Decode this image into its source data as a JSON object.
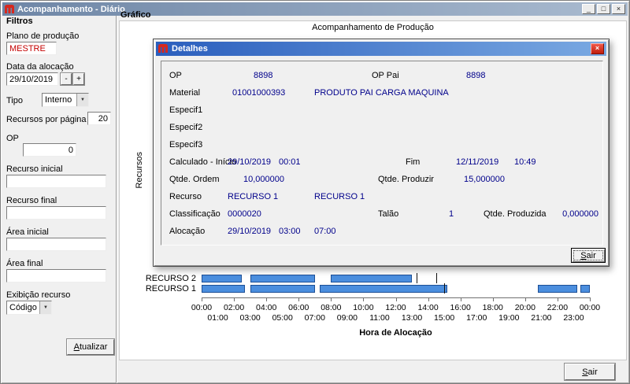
{
  "window": {
    "title": "Acompanhamento - Diário",
    "minimize_glyph": "_",
    "maximize_glyph": "□",
    "close_glyph": "×"
  },
  "icons": {
    "combo_arrow": "▼"
  },
  "filters": {
    "heading": "Filtros",
    "plano": {
      "label": "Plano de produção",
      "value": "MESTRE"
    },
    "data_alocacao": {
      "label": "Data da alocação",
      "value": "29/10/2019",
      "minus": "-",
      "plus": "+"
    },
    "tipo": {
      "label": "Tipo",
      "value": "Interno"
    },
    "recursos_por_pagina": {
      "label": "Recursos por página",
      "value": "20"
    },
    "op": {
      "label": "OP",
      "value": "0"
    },
    "recurso_inicial": {
      "label": "Recurso inicial",
      "value": ""
    },
    "recurso_final": {
      "label": "Recurso final",
      "value": ""
    },
    "area_inicial": {
      "label": "Área inicial",
      "value": ""
    },
    "area_final": {
      "label": "Área final",
      "value": ""
    },
    "exibicao_recurso": {
      "label": "Exibição recurso",
      "value": "Código"
    },
    "atualizar_button": "Atualizar"
  },
  "main": {
    "group_label": "Gráfico",
    "sair_button": "Sair"
  },
  "dialog": {
    "title": "Detalhes",
    "close_glyph": "×",
    "op": {
      "label": "OP",
      "value": "8898"
    },
    "op_pai": {
      "label": "OP Pai",
      "value": "8898"
    },
    "material": {
      "label": "Material",
      "code": "01001000393",
      "desc": "PRODUTO PAI CARGA MAQUINA"
    },
    "especif1": {
      "label": "Especif1",
      "value": ""
    },
    "especif2": {
      "label": "Especif2",
      "value": ""
    },
    "especif3": {
      "label": "Especif3",
      "value": ""
    },
    "calculado": {
      "label": "Calculado - Início",
      "date": "29/10/2019",
      "time": "00:01"
    },
    "fim": {
      "label": "Fim",
      "date": "12/11/2019",
      "time": "10:49"
    },
    "qtde_ordem": {
      "label": "Qtde. Ordem",
      "value": "10,000000"
    },
    "qtde_produzir": {
      "label": "Qtde. Produzir",
      "value": "15,000000"
    },
    "recurso": {
      "label": "Recurso",
      "code": "RECURSO 1",
      "desc": "RECURSO 1"
    },
    "classificacao": {
      "label": "Classificação",
      "value": "0000020"
    },
    "talao": {
      "label": "Talão",
      "value": "1"
    },
    "qtde_produzida": {
      "label": "Qtde. Produzida",
      "value": "0,000000"
    },
    "alocacao": {
      "label": "Alocação",
      "date": "29/10/2019",
      "time_start": "03:00",
      "time_end": "07:00"
    },
    "sair_button": "Sair"
  },
  "chart_data": {
    "type": "gantt",
    "title": "Acompanhamento de Produção",
    "xlabel": "Hora de Alocação",
    "ylabel": "Recursos",
    "xlim_hours": [
      0,
      24
    ],
    "tick_labels_even": [
      "00:00",
      "02:00",
      "04:00",
      "06:00",
      "08:00",
      "10:00",
      "12:00",
      "14:00",
      "16:00",
      "18:00",
      "20:00",
      "22:00",
      "00:00"
    ],
    "tick_labels_odd": [
      "01:00",
      "03:00",
      "05:00",
      "07:00",
      "09:00",
      "11:00",
      "13:00",
      "15:00",
      "17:00",
      "19:00",
      "21:00",
      "23:00"
    ],
    "bar_color": "#4b8ede",
    "bar_border": "#1d4f96",
    "rows": [
      {
        "label": "RECURSO 2",
        "bars": [
          [
            0,
            2.5
          ],
          [
            3,
            7
          ],
          [
            8,
            13
          ]
        ],
        "markers": [
          13.3,
          14.5
        ]
      },
      {
        "label": "RECURSO 1",
        "bars": [
          [
            0,
            2.7
          ],
          [
            3,
            7
          ],
          [
            7.3,
            15.2
          ],
          [
            20.8,
            23.2
          ],
          [
            23.4,
            24
          ]
        ],
        "markers": [
          15.0
        ]
      }
    ]
  }
}
